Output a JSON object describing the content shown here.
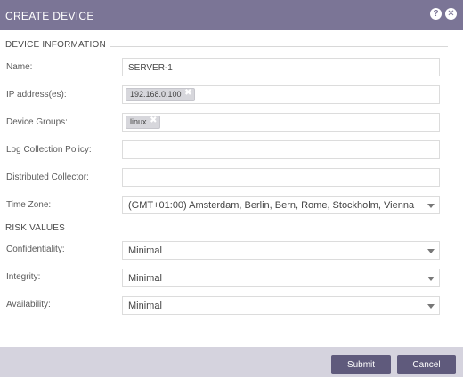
{
  "dialog": {
    "title": "CREATE DEVICE",
    "help_glyph": "?",
    "close_glyph": "✕"
  },
  "sections": {
    "device_info": "DEVICE INFORMATION",
    "risk_values": "RISK VALUES"
  },
  "fields": {
    "name": {
      "label": "Name:",
      "value": "SERVER-1"
    },
    "ip": {
      "label": "IP address(es):",
      "tags": [
        "192.168.0.100"
      ]
    },
    "groups": {
      "label": "Device Groups:",
      "tags": [
        "linux"
      ]
    },
    "log_policy": {
      "label": "Log Collection Policy:",
      "value": ""
    },
    "collector": {
      "label": "Distributed Collector:",
      "value": ""
    },
    "timezone": {
      "label": "Time Zone:",
      "value": "(GMT+01:00) Amsterdam, Berlin, Bern, Rome, Stockholm, Vienna"
    },
    "confidentiality": {
      "label": "Confidentiality:",
      "value": "Minimal"
    },
    "integrity": {
      "label": "Integrity:",
      "value": "Minimal"
    },
    "availability": {
      "label": "Availability:",
      "value": "Minimal"
    }
  },
  "tag_remove_glyph": "✖",
  "buttons": {
    "submit": "Submit",
    "cancel": "Cancel"
  },
  "colors": {
    "header": "#7b7596",
    "button": "#5f5a7c",
    "footer": "#d5d3de"
  }
}
